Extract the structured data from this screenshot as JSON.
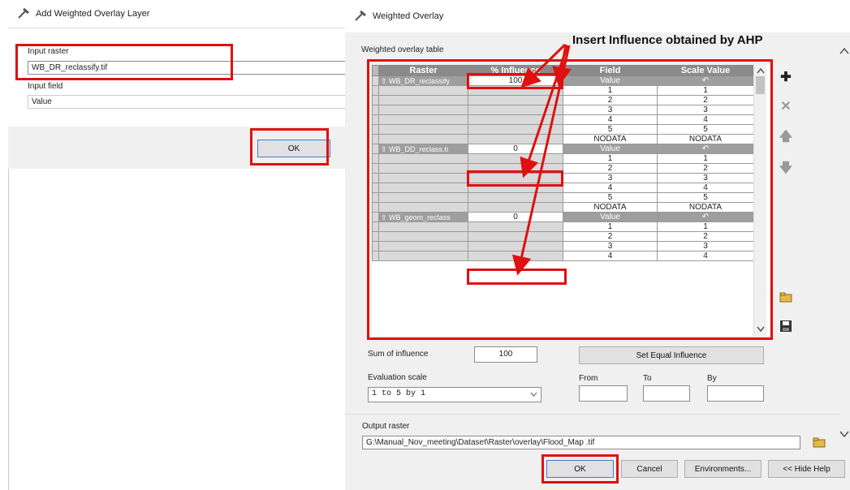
{
  "left_dialog": {
    "title": "Add Weighted Overlay Layer",
    "input_raster_label": "Input raster",
    "input_raster_value": "WB_DR_reclassify.tif",
    "input_field_label": "Input field",
    "input_field_value": "Value",
    "ok_label": "OK"
  },
  "right_dialog": {
    "title": "Weighted Overlay",
    "annotation": "Insert Influence obtained by AHP",
    "table_label": "Weighted overlay table",
    "columns": [
      "Raster",
      "% Influence",
      "Field",
      "Scale Value"
    ],
    "groups": [
      {
        "raster": "WB_DR_reclassify",
        "influence": "100",
        "field_header": "Value",
        "rows": [
          [
            "1",
            "1"
          ],
          [
            "2",
            "2"
          ],
          [
            "3",
            "3"
          ],
          [
            "4",
            "4"
          ],
          [
            "5",
            "5"
          ],
          [
            "NODATA",
            "NODATA"
          ]
        ]
      },
      {
        "raster": "WB_DD_reclass.ti",
        "influence": "0",
        "field_header": "Value",
        "rows": [
          [
            "1",
            "1"
          ],
          [
            "2",
            "2"
          ],
          [
            "3",
            "3"
          ],
          [
            "4",
            "4"
          ],
          [
            "5",
            "5"
          ],
          [
            "NODATA",
            "NODATA"
          ]
        ]
      },
      {
        "raster": "WB_geom_reclass",
        "influence": "0",
        "field_header": "Value",
        "rows": [
          [
            "1",
            "1"
          ],
          [
            "2",
            "2"
          ],
          [
            "3",
            "3"
          ],
          [
            "4",
            "4"
          ]
        ]
      }
    ],
    "sum_label": "Sum of influence",
    "sum_value": "100",
    "equal_label": "Set Equal Influence",
    "eval_label": "Evaluation scale",
    "eval_value": "1  to  5  by  1",
    "from_label": "From",
    "to_label": "To",
    "by_label": "By",
    "output_label": "Output raster",
    "output_value": "G:\\Manual_Nov_meeting\\Dataset\\Raster\\overlay\\Flood_Map .tif",
    "ok_label": "OK",
    "cancel_label": "Cancel",
    "env_label": "Environments...",
    "help_label": "<< Hide Help"
  },
  "colors": {
    "annotation_red": "#e01010",
    "header_grey": "#8a8a8a"
  }
}
